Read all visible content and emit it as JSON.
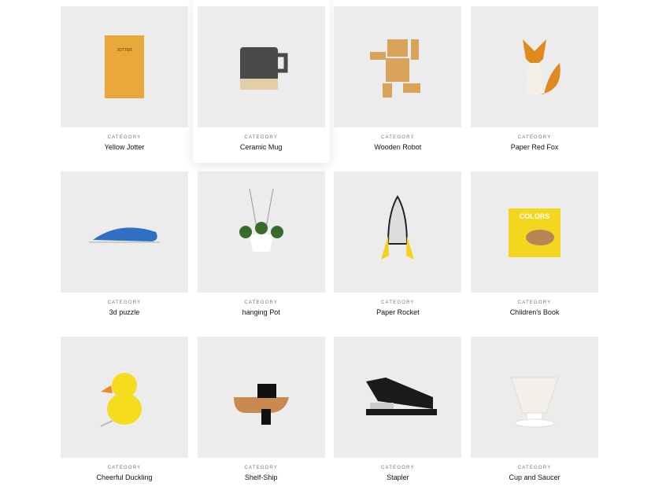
{
  "products": [
    {
      "category": "CATEGORY",
      "name": "Yellow Jotter",
      "icon": "notebook-icon",
      "color": "#e9a93a"
    },
    {
      "category": "CATEGORY",
      "name": "Ceramic Mug",
      "icon": "mug-icon",
      "color": "#4a4a4a"
    },
    {
      "category": "CATEGORY",
      "name": "Wooden Robot",
      "icon": "robot-icon",
      "color": "#d9a35c"
    },
    {
      "category": "CATEGORY",
      "name": "Paper Red Fox",
      "icon": "fox-icon",
      "color": "#e08a1e"
    },
    {
      "category": "CATEGORY",
      "name": "3d puzzle",
      "icon": "whale-icon",
      "color": "#2f6fc4"
    },
    {
      "category": "CATEGORY",
      "name": "hanging Pot",
      "icon": "plant-icon",
      "color": "#3a6b2c"
    },
    {
      "category": "CATEGORY",
      "name": "Paper Rocket",
      "icon": "rocket-icon",
      "color": "#f2d21b"
    },
    {
      "category": "CATEGORY",
      "name": "Children's Book",
      "icon": "book-icon",
      "color": "#f3d61e"
    },
    {
      "category": "CATEGORY",
      "name": "Cheerful Duckling",
      "icon": "duck-icon",
      "color": "#f5dc1c"
    },
    {
      "category": "CATEGORY",
      "name": "Shelf-Ship",
      "icon": "shelf-icon",
      "color": "#c98a4f"
    },
    {
      "category": "CATEGORY",
      "name": "Stapler",
      "icon": "stapler-icon",
      "color": "#1a1a1a"
    },
    {
      "category": "CATEGORY",
      "name": "Cup and Saucer",
      "icon": "cup-icon",
      "color": "#f4efe8"
    }
  ]
}
